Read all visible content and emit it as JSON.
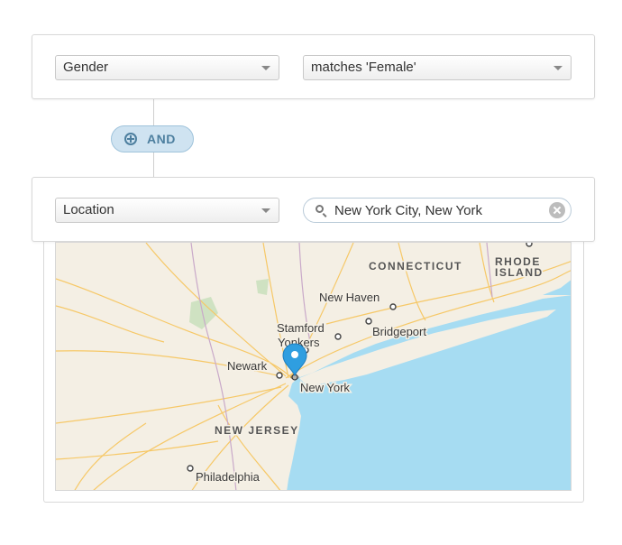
{
  "condition1": {
    "field": "Gender",
    "operator": "matches 'Female'"
  },
  "joiner": {
    "label": "AND",
    "icon": "plus-circle-icon"
  },
  "condition2": {
    "field": "Location",
    "search_value": "New York City, New York",
    "search_icon": "magnifier-icon",
    "clear_icon": "clear-x-icon"
  },
  "map": {
    "cities": [
      "Stamford",
      "Yonkers",
      "New Haven",
      "Bridgeport",
      "Newark",
      "New York",
      "Philadelphia"
    ],
    "states": [
      "CONNECTICUT",
      "RHODE ISLAND",
      "NEW JERSEY"
    ],
    "pin_color": "#2f9ee0",
    "water_color": "#a6dcf2",
    "land_color": "#f4efe4"
  },
  "colors": {
    "accent": "#4d7f9f",
    "pill_bg": "#cfe3f1"
  }
}
